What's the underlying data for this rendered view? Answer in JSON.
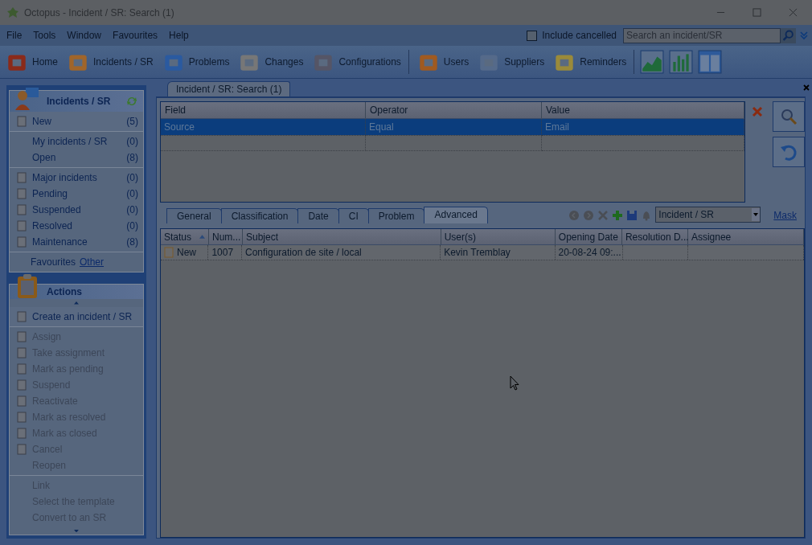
{
  "window": {
    "title": "Octopus - Incident / SR: Search (1)"
  },
  "menu": [
    "File",
    "Tools",
    "Window",
    "Favourites",
    "Help"
  ],
  "include_cancelled": {
    "label": "Include cancelled",
    "checked": false
  },
  "search": {
    "placeholder": "Search an incident/SR"
  },
  "toolbar": [
    {
      "label": "Home"
    },
    {
      "label": "Incidents / SR"
    },
    {
      "label": "Problems"
    },
    {
      "label": "Changes"
    },
    {
      "label": "Configurations"
    },
    {
      "label": "Users"
    },
    {
      "label": "Suppliers"
    },
    {
      "label": "Reminders"
    }
  ],
  "incidents_panel": {
    "title": "Incidents / SR",
    "groups": [
      [
        {
          "label": "New",
          "count": "(5)"
        }
      ],
      [
        {
          "label": "My incidents / SR",
          "count": "(0)"
        },
        {
          "label": "Open",
          "count": "(8)"
        }
      ],
      [
        {
          "label": "Major incidents",
          "count": "(0)"
        },
        {
          "label": "Pending",
          "count": "(0)"
        },
        {
          "label": "Suspended",
          "count": "(0)"
        },
        {
          "label": "Resolved",
          "count": "(0)"
        },
        {
          "label": "Maintenance",
          "count": "(8)"
        }
      ]
    ],
    "favourites": {
      "label": "Favourites",
      "link": "Other"
    }
  },
  "actions_panel": {
    "title": "Actions",
    "groups": [
      [
        {
          "label": "Create an incident / SR",
          "disabled": false
        }
      ],
      [
        {
          "label": "Assign",
          "disabled": true
        },
        {
          "label": "Take assignment",
          "disabled": true
        },
        {
          "label": "Mark as pending",
          "disabled": true
        },
        {
          "label": "Suspend",
          "disabled": true
        },
        {
          "label": "Reactivate",
          "disabled": true
        },
        {
          "label": "Mark as resolved",
          "disabled": true
        },
        {
          "label": "Mark as closed",
          "disabled": true
        },
        {
          "label": "Cancel",
          "disabled": true
        },
        {
          "label": "Reopen",
          "disabled": true
        }
      ],
      [
        {
          "label": "Link",
          "disabled": true
        },
        {
          "label": "Select the template",
          "disabled": true
        },
        {
          "label": "Convert to an SR",
          "disabled": true
        }
      ]
    ]
  },
  "document_tab": {
    "label": "Incident / SR: Search (1)"
  },
  "criteria": {
    "columns": [
      "Field",
      "Operator",
      "Value"
    ],
    "rows": [
      {
        "cells": [
          "Source",
          "Equal",
          "Email"
        ],
        "selected": true
      }
    ]
  },
  "criteria_tabs": [
    {
      "label": "General",
      "selected": false
    },
    {
      "label": "Classification",
      "selected": false
    },
    {
      "label": "Date",
      "selected": false
    },
    {
      "label": "CI",
      "selected": false
    },
    {
      "label": "Problem",
      "selected": false
    },
    {
      "label": "Advanced",
      "selected": true
    }
  ],
  "type_select": {
    "value": "Incident / SR"
  },
  "mask_link": "Mask",
  "results": {
    "columns": [
      {
        "label": "Status",
        "sorted": true
      },
      {
        "label": "Num...",
        "sorted": false
      },
      {
        "label": "Subject",
        "sorted": false
      },
      {
        "label": "User(s)",
        "sorted": false
      },
      {
        "label": "Opening Date",
        "sorted": false
      },
      {
        "label": "Resolution D...",
        "sorted": false
      },
      {
        "label": "Assignee",
        "sorted": false
      }
    ],
    "rows": [
      {
        "cells": [
          "New",
          "1007",
          "Configuration de site / local",
          "Kevin Tremblay",
          "20-08-24 09:...",
          "",
          ""
        ]
      }
    ]
  }
}
